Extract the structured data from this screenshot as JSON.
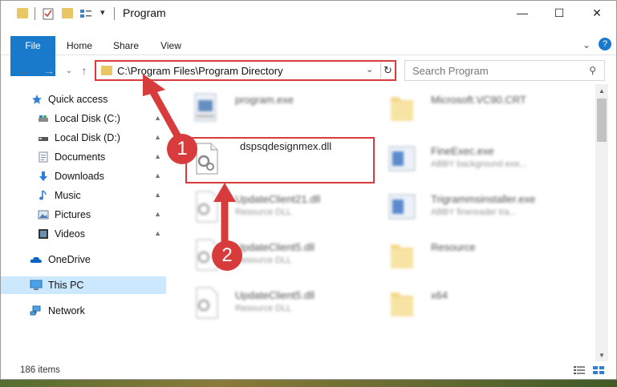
{
  "window": {
    "title": "Program",
    "min_glyph": "—",
    "max_glyph": "☐",
    "close_glyph": "✕",
    "qa_dropdown_glyph": "▾"
  },
  "ribbon": {
    "tabs": [
      "File",
      "Home",
      "Share",
      "View"
    ],
    "collapse_glyph": "⌄",
    "help_glyph": "?"
  },
  "nav": {
    "back_glyph": "←",
    "forward_glyph": "→",
    "recent_glyph": "⌄",
    "up_glyph": "↑"
  },
  "address": {
    "path": "C:\\Program Files\\Program Directory",
    "dropdown_glyph": "⌄",
    "refresh_glyph": "↻"
  },
  "search": {
    "placeholder": "Search Program",
    "icon_glyph": "⚲"
  },
  "sidebar": {
    "quick_access": "Quick access",
    "items": [
      {
        "label": "Local Disk (C:)"
      },
      {
        "label": "Local Disk (D:)"
      },
      {
        "label": "Documents"
      },
      {
        "label": "Downloads"
      },
      {
        "label": "Music"
      },
      {
        "label": "Pictures"
      },
      {
        "label": "Videos"
      }
    ],
    "pin_glyph": "📌",
    "onedrive": "OneDrive",
    "this_pc": "This PC",
    "network": "Network"
  },
  "files": {
    "left_column": [
      {
        "name": "program.exe",
        "sub": ""
      },
      {
        "name": "dspsqdesignmex.dll",
        "sub": ""
      },
      {
        "name": "UpdateClient21.dll",
        "sub": "Resource DLL"
      },
      {
        "name": "UpdateClient5.dll",
        "sub": "Resource DLL"
      },
      {
        "name": "UpdateClient5.dll",
        "sub": "Resource DLL"
      }
    ],
    "right_column": [
      {
        "name": "Microsoft.VC90.CRT",
        "sub": ""
      },
      {
        "name": "FineExec.exe",
        "sub": "ABBY background exe..."
      },
      {
        "name": "Trigrammsinstaller.exe",
        "sub": "ABBY finereader tra..."
      },
      {
        "name": "Resource",
        "sub": ""
      },
      {
        "name": "x64",
        "sub": ""
      }
    ]
  },
  "scrollbar": {
    "up_glyph": "▲",
    "down_glyph": "▼"
  },
  "status": {
    "item_count": "186 items"
  },
  "annotations": {
    "step1": "1",
    "step2": "2",
    "color": "#d83b3b"
  }
}
